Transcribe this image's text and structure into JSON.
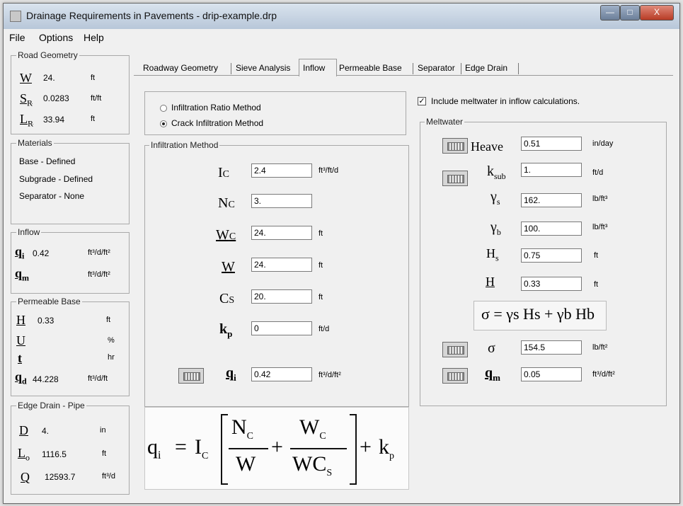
{
  "title": "Drainage Requirements in Pavements - drip-example.drp",
  "window_buttons": {
    "minimize": "—",
    "maximize": "□",
    "close": "X"
  },
  "menu": [
    "File",
    "Options",
    "Help"
  ],
  "road_geometry": {
    "title": "Road Geometry",
    "W": {
      "sym": "W",
      "value": "24.",
      "unit": "ft"
    },
    "SR": {
      "sym": "S",
      "sub": "R",
      "value": "0.0283",
      "unit": "ft/ft"
    },
    "LR": {
      "sym": "L",
      "sub": "R",
      "value": "33.94",
      "unit": "ft"
    }
  },
  "materials": {
    "title": "Materials",
    "items": [
      "Base - Defined",
      "Subgrade - Defined",
      "Separator - None"
    ]
  },
  "inflow_summary": {
    "title": "Inflow",
    "qi": {
      "sym": "q",
      "sub": "i",
      "value": "0.42",
      "unit": "ft³/d/ft²"
    },
    "qm": {
      "sym": "q",
      "sub": "m",
      "value": "",
      "unit": "ft³/d/ft²"
    }
  },
  "permeable_base": {
    "title": "Permeable Base",
    "H": {
      "sym": "H",
      "value": "0.33",
      "unit": "ft"
    },
    "U": {
      "sym": "U",
      "value": "",
      "unit": "%"
    },
    "t": {
      "sym": "t",
      "value": "",
      "unit": "hr"
    },
    "qd": {
      "sym": "q",
      "sub": "d",
      "value": "44.228",
      "unit": "ft³/d/ft"
    }
  },
  "edge_drain": {
    "title": "Edge Drain - Pipe",
    "D": {
      "sym": "D",
      "value": "4.",
      "unit": "in"
    },
    "Lo": {
      "sym": "L",
      "sub": "o",
      "value": "1116.5",
      "unit": "ft"
    },
    "Q": {
      "sym": "Q",
      "value": "12593.7",
      "unit": "ft³/d"
    }
  },
  "tabs": [
    "Roadway Geometry",
    "Sieve Analysis",
    "Inflow",
    "Permeable Base",
    "Separator",
    "Edge Drain"
  ],
  "active_tab": "Inflow",
  "method": {
    "options": [
      "Infiltration Ratio Method",
      "Crack Infiltration Method"
    ],
    "selected": "Crack Infiltration Method"
  },
  "infiltration": {
    "title": "Infiltration Method",
    "Ic": {
      "sym": "I",
      "sub": "C",
      "value": "2.4",
      "unit": "ft³/ft/d"
    },
    "Nc": {
      "sym": "N",
      "sub": "C",
      "value": "3.",
      "unit": ""
    },
    "Wc": {
      "sym": "W",
      "sub": "C",
      "value": "24.",
      "unit": "ft"
    },
    "W": {
      "sym": "W",
      "value": "24.",
      "unit": "ft"
    },
    "Cs": {
      "sym": "C",
      "sub": "S",
      "value": "20.",
      "unit": "ft"
    },
    "kp": {
      "sym": "k",
      "sub": "p",
      "value": "0",
      "unit": "ft/d"
    },
    "qi": {
      "sym": "q",
      "sub": "i",
      "value": "0.42",
      "unit": "ft³/d/ft²"
    }
  },
  "formula_main": {
    "lhs": "q",
    "lhs_sub": "i",
    "eq": "=",
    "ic": "I",
    "ic_sub": "C",
    "n1": "N",
    "n1_sub": "C",
    "d1": "W",
    "n2": "W",
    "n2_sub": "C",
    "d2": "WC",
    "d2_sub": "S",
    "plus": "+",
    "kp": "k",
    "kp_sub": "p"
  },
  "meltwater_check": {
    "label": "Include meltwater in inflow calculations.",
    "checked": true
  },
  "meltwater": {
    "title": "Meltwater",
    "heave": {
      "sym": "Heave",
      "value": "0.51",
      "unit": "in/day"
    },
    "ksub": {
      "sym": "k",
      "sub": "sub",
      "value": "1.",
      "unit": "ft/d"
    },
    "gs": {
      "sym": "γ",
      "sub": "s",
      "value": "162.",
      "unit": "lb/ft³"
    },
    "gb": {
      "sym": "γ",
      "sub": "b",
      "value": "100.",
      "unit": "lb/ft³"
    },
    "Hs": {
      "sym": "H",
      "sub": "s",
      "value": "0.75",
      "unit": "ft"
    },
    "H": {
      "sym": "H",
      "value": "0.33",
      "unit": "ft"
    },
    "sigma": {
      "sym": "σ",
      "value": "154.5",
      "unit": "lb/ft²"
    },
    "qm": {
      "sym": "q",
      "sub": "m",
      "value": "0.05",
      "unit": "ft³/d/ft²"
    },
    "formula": "σ = γs Hs + γb Hb"
  }
}
